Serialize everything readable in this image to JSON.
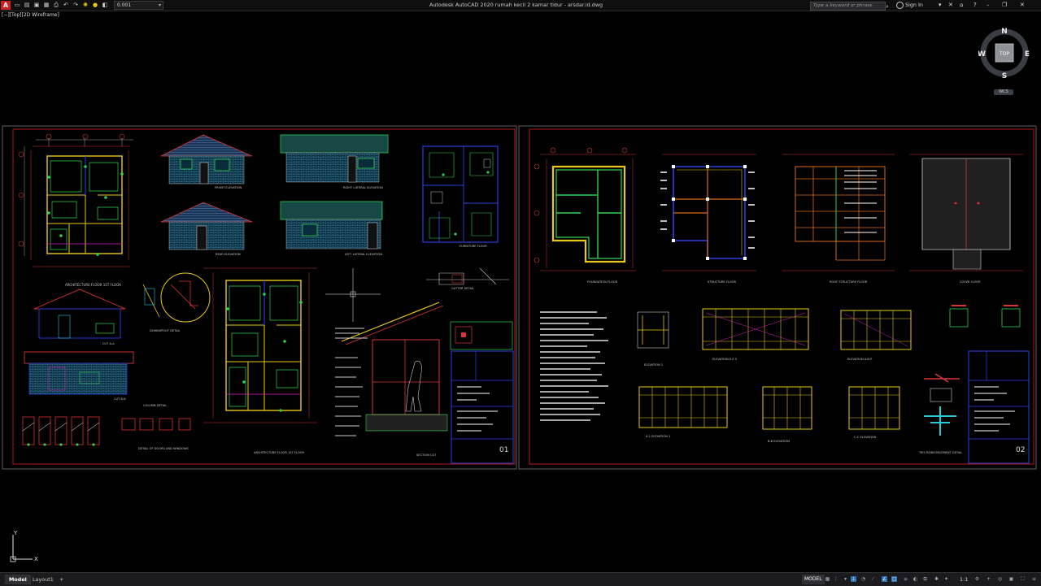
{
  "titlebar": {
    "app_logo": "A",
    "layer_combo_value": "0.001",
    "window_title": "Autodesk AutoCAD 2020   rumah kecil 2 kamar tidur - arsdar.id.dwg",
    "search_placeholder": "Type a keyword or phrase",
    "sign_in": "Sign In",
    "qat_icons": [
      "new-icon",
      "open-icon",
      "save-icon",
      "saveas-icon",
      "print-icon",
      "undo-icon",
      "redo-icon",
      "sun-icon",
      "layer-icon"
    ]
  },
  "viewport": {
    "label": "[−][Top][2D Wireframe]"
  },
  "viewcube": {
    "north": "N",
    "south": "S",
    "east": "E",
    "west": "W",
    "face": "TOP",
    "wcs": "WCS"
  },
  "ucs": {
    "x": "X",
    "y": "Y"
  },
  "sheet1": {
    "labels": {
      "plan1": "ARCHITECTURE FLOOR 1ST FLOOR",
      "elev_front": "FRONT ELEVATION",
      "elev_right": "RIGHT LATERAL ELEVATION",
      "elev_rear": "REAR ELEVATION",
      "elev_left": "LEFT LATERAL ELEVATION",
      "furniture": "FURNITURE FLOOR",
      "cut_aa": "CUT A-A",
      "cut_bb": "CUT B-B",
      "downspout": "DOWNSPOUT DETAIL",
      "gutter": "GUTTER DETAIL",
      "column": "COLUMN DETAIL",
      "plan2": "ARCHITECTURE FLOOR 1ST FLOOR",
      "section": "SECTION CUT",
      "doors": "DETAIL OF DOORS AND WINDOWS",
      "sheet_no": "01"
    }
  },
  "sheet2": {
    "labels": {
      "foundation": "FOUNDATION FLOOR",
      "structure": "STRUCTURE FLOOR",
      "roof_structure": "ROOF STRUCTURE FLOOR",
      "cover": "COVER FLOOR",
      "elev1": "ELEVATION 1",
      "elev_e5": "ELEVATION E-E 5",
      "elev_ab": "ELEVATION A-B-P",
      "elev_a1": "A-1 ELEVATION 1",
      "elev_b": "B-B ELEVATION",
      "elev_c": "C-C ELEVATION",
      "ties": "TIES REINFORCEMENT DETAIL",
      "sheet_no": "02"
    }
  },
  "statusbar": {
    "tab_model": "Model",
    "tab_layout1": "Layout1",
    "tab_add": "+",
    "model_label": "MODEL",
    "scale": "1:1"
  },
  "colors": {
    "background": "#000000",
    "sheet_border": "#b01818",
    "wall_yellow": "#e8c81a",
    "wall_green": "#2fd24f",
    "blue": "#2c3fe0",
    "magenta": "#d91ec7",
    "cyan": "#27c9d6",
    "roof_blue": "#3a5a8a"
  }
}
